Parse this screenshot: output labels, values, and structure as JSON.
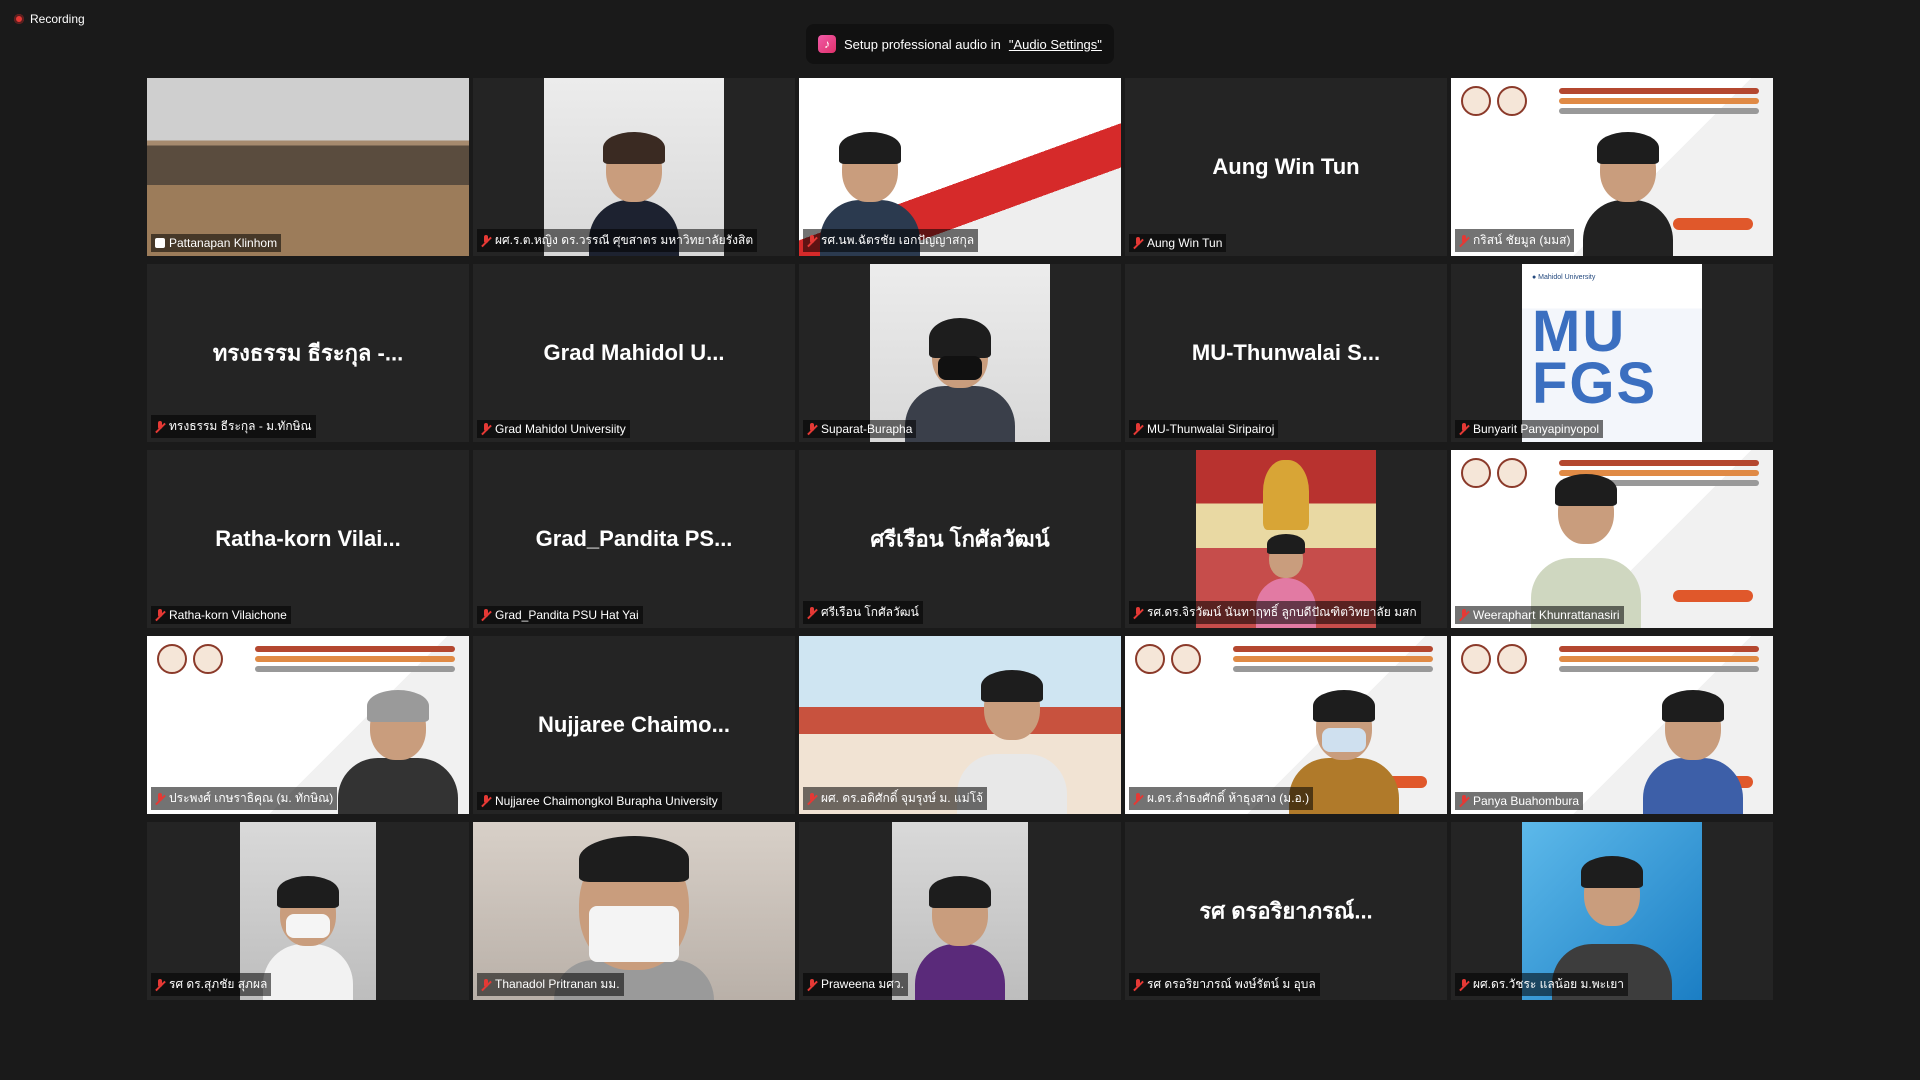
{
  "recording": {
    "label": "Recording"
  },
  "banner": {
    "text": "Setup professional audio in ",
    "link": "\"Audio Settings\""
  },
  "participants": [
    {
      "big": "",
      "name": "Pattanapan Klinhom"
    },
    {
      "big": "",
      "name": "ผศ.ร.ต.หญิง ดร.วรรณี ศุขสาตร มหาวิทยาลัยรังสิต"
    },
    {
      "big": "",
      "name": "รศ.นพ.ฉัตรชัย เอกปัญญาสกุล"
    },
    {
      "big": "Aung Win Tun",
      "name": "Aung Win Tun"
    },
    {
      "big": "",
      "name": "กริสน์ ชัยมูล (มมส)"
    },
    {
      "big": "ทรงธรรม ธีระกุล -...",
      "name": "ทรงธรรม ธีระกุล - ม.ทักษิณ"
    },
    {
      "big": "Grad Mahidol U...",
      "name": "Grad Mahidol Universiity"
    },
    {
      "big": "",
      "name": "Suparat-Burapha"
    },
    {
      "big": "MU-Thunwalai S...",
      "name": "MU-Thunwalai Siripairoj"
    },
    {
      "big": "",
      "name": "Bunyarit Panyapinyopol"
    },
    {
      "big": "Ratha-korn Vilai...",
      "name": "Ratha-korn Vilaichone"
    },
    {
      "big": "Grad_Pandita PS...",
      "name": "Grad_Pandita PSU Hat Yai"
    },
    {
      "big": "ศรีเรือน โกศัลวัฒน์",
      "name": "ศรีเรือน โกศัลวัฒน์"
    },
    {
      "big": "",
      "name": "รศ.ดร.จิรวัฒน์ นันทาฤทธิ์ ลูกบดีปัณฑิตวิทยาลัย มสก"
    },
    {
      "big": "",
      "name": "Weeraphart Khunrattanasiri"
    },
    {
      "big": "",
      "name": "ประพงศ์ เกษราธิคุณ (ม. ทักษิณ)"
    },
    {
      "big": "Nujjaree  Chaimo...",
      "name": "Nujjaree Chaimongkol Burapha University"
    },
    {
      "big": "",
      "name": "ผศ. ดร.อดิศักดิ์ จุมรุงษ์ ม. แม่โจ้"
    },
    {
      "big": "",
      "name": "ผ.ดร.ลำธงศักดิ์ ห้าธุงสาง (ม.อ.)"
    },
    {
      "big": "",
      "name": "Panya Buahombura"
    },
    {
      "big": "",
      "name": "รศ ดร.สุภชัย สุภผล"
    },
    {
      "big": "",
      "name": "Thanadol Pritranan มม."
    },
    {
      "big": "",
      "name": "Praweena มศว."
    },
    {
      "big": "รศ ดรอริยาภรณ์...",
      "name": "รศ ดรอริยาภรณ์ พงษ์รัตน์ ม อุบล"
    },
    {
      "big": "",
      "name": "ผศ.ดร.วัชระ แลน้อย ม.พะเยา"
    }
  ],
  "slide_text": {
    "mu": "MU\nFGS"
  },
  "colors": {
    "background": "#1a1a1a",
    "tile": "#242424",
    "active_border": "#e2e04a",
    "mic_muted": "#e53935"
  }
}
